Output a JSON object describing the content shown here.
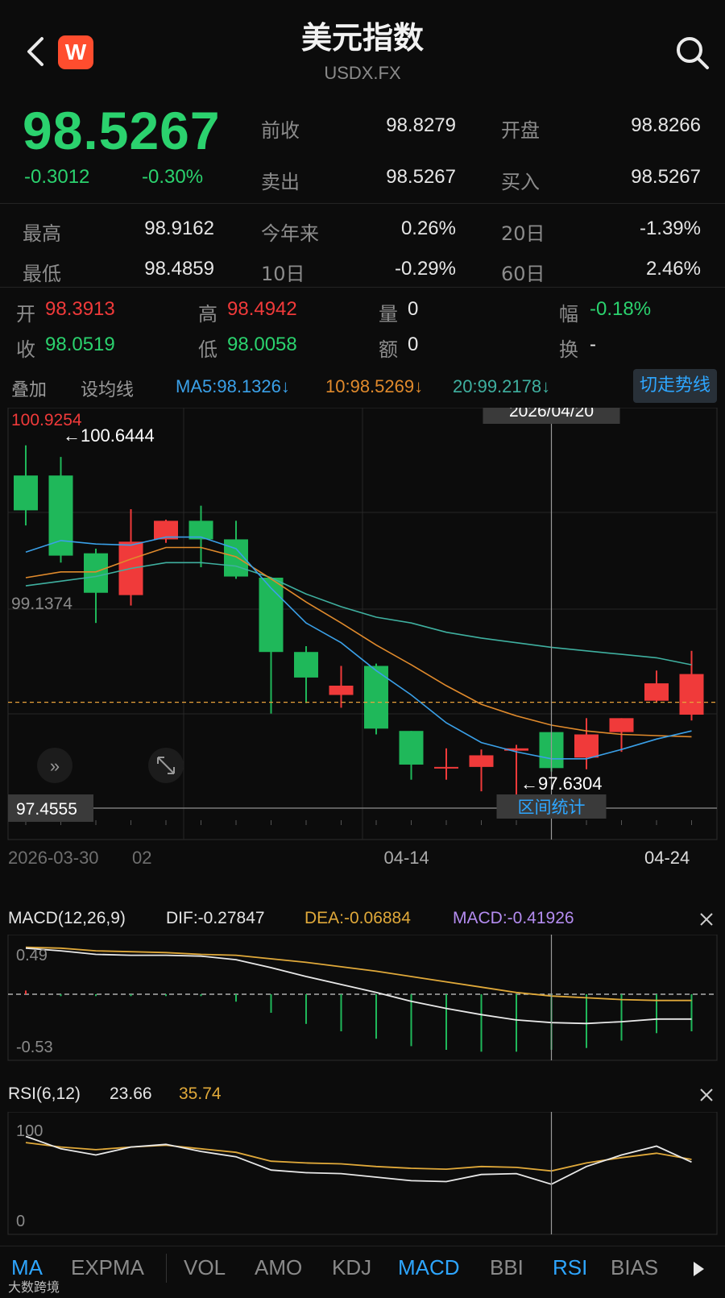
{
  "header": {
    "title": "美元指数",
    "subtitle": "USDX.FX",
    "logo_letter": "W"
  },
  "quote": {
    "price": "98.5267",
    "change": "-0.3012",
    "change_pct": "-0.30%",
    "prev_close_label": "前收",
    "prev_close": "98.8279",
    "open_label": "开盘",
    "open": "98.8266",
    "ask_label": "卖出",
    "ask": "98.5267",
    "bid_label": "买入",
    "bid": "98.5267",
    "high_label": "最高",
    "high": "98.9162",
    "ytd_label": "今年来",
    "ytd": "0.26%",
    "d20_label": "20日",
    "d20": "-1.39%",
    "low_label": "最低",
    "low": "98.4859",
    "d10_label": "10日",
    "d10": "-0.29%",
    "d60_label": "60日",
    "d60": "2.46%"
  },
  "candle_info": {
    "open_label": "开",
    "open": "98.3913",
    "high_label": "高",
    "high": "98.4942",
    "vol_label": "量",
    "vol": "0",
    "amp_label": "幅",
    "amp": "-0.18%",
    "close_label": "收",
    "close": "98.0519",
    "low_label": "低",
    "low": "98.0058",
    "amt_label": "额",
    "amt": "0",
    "turn_label": "换",
    "turn": "-"
  },
  "toolbar": {
    "overlay": "叠加",
    "set_ma": "设均线",
    "ma5": "MA5:98.1326↓",
    "ma10": "10:98.5269↓",
    "ma20": "20:99.2178↓",
    "trend_button": "切走势线"
  },
  "main_chart": {
    "top_price_label": "100.9254",
    "max_annotation": "←100.6444",
    "mid_price_label": "99.1374",
    "bottom_price_label": "97.4555",
    "min_annotation": "←97.6304",
    "crosshair_date": "2026/04/20",
    "range_stats": "区间统计",
    "date_labels": [
      "2026-03-30",
      "02",
      "04-14",
      "04-24"
    ]
  },
  "macd": {
    "title": "MACD(12,26,9)",
    "dif": "DIF:-0.27847",
    "dea": "DEA:-0.06884",
    "macd": "MACD:-0.41926",
    "top_label": "0.49",
    "bottom_label": "-0.53"
  },
  "rsi": {
    "title": "RSI(6,12)",
    "v1": "23.66",
    "v2": "35.74",
    "top_label": "100",
    "bottom_label": "0"
  },
  "tabs": [
    "MA",
    "EXPMA",
    "VOL",
    "AMO",
    "KDJ",
    "MACD",
    "BBI",
    "RSI",
    "BIAS"
  ],
  "watermark": "大数跨境",
  "colors": {
    "up": "#f03a3a",
    "down": "#1fb85a",
    "ma5": "#3aa0e8",
    "ma10": "#e08a2c",
    "ma20": "#3fb0a0",
    "accent": "#2ea6ff"
  },
  "chart_data": {
    "type": "candlestick",
    "ylim": [
      97.4555,
      100.9254
    ],
    "candles": [
      {
        "o": 100.48,
        "c": 100.18,
        "h": 100.74,
        "l": 100.05
      },
      {
        "o": 100.48,
        "c": 99.79,
        "h": 100.64,
        "l": 99.73
      },
      {
        "o": 99.81,
        "c": 99.47,
        "h": 99.85,
        "l": 99.21
      },
      {
        "o": 99.45,
        "c": 99.91,
        "h": 100.19,
        "l": 99.36
      },
      {
        "o": 99.93,
        "c": 100.09,
        "h": 100.1,
        "l": 99.9
      },
      {
        "o": 100.09,
        "c": 99.93,
        "h": 100.22,
        "l": 99.69
      },
      {
        "o": 99.93,
        "c": 99.61,
        "h": 100.09,
        "l": 99.59
      },
      {
        "o": 99.6,
        "c": 98.96,
        "h": 99.6,
        "l": 98.43
      },
      {
        "o": 98.96,
        "c": 98.74,
        "h": 99.01,
        "l": 98.52
      },
      {
        "o": 98.59,
        "c": 98.67,
        "h": 98.84,
        "l": 98.48
      },
      {
        "o": 98.84,
        "c": 98.3,
        "h": 98.86,
        "l": 98.25
      },
      {
        "o": 98.28,
        "c": 97.99,
        "h": 98.28,
        "l": 97.86
      },
      {
        "o": 97.97,
        "c": 97.97,
        "h": 98.13,
        "l": 97.86
      },
      {
        "o": 97.97,
        "c": 98.07,
        "h": 98.12,
        "l": 97.76
      },
      {
        "o": 98.11,
        "c": 98.13,
        "h": 98.16,
        "l": 97.63
      },
      {
        "o": 98.27,
        "c": 97.96,
        "h": 98.27,
        "l": 97.93
      },
      {
        "o": 98.05,
        "c": 98.25,
        "h": 98.39,
        "l": 97.95
      },
      {
        "o": 98.27,
        "c": 98.39,
        "h": 98.39,
        "l": 98.1
      },
      {
        "o": 98.54,
        "c": 98.69,
        "h": 98.8,
        "l": 98.53
      },
      {
        "o": 98.42,
        "c": 98.77,
        "h": 98.97,
        "l": 98.37
      }
    ],
    "ma5": [
      99.82,
      99.92,
      99.89,
      99.88,
      99.95,
      99.95,
      99.85,
      99.51,
      99.21,
      99.04,
      98.8,
      98.59,
      98.35,
      98.18,
      98.1,
      98.04,
      98.04,
      98.12,
      98.21,
      98.28
    ],
    "ma10": [
      99.6,
      99.65,
      99.65,
      99.76,
      99.86,
      99.86,
      99.78,
      99.59,
      99.39,
      99.21,
      99.02,
      98.85,
      98.67,
      98.51,
      98.41,
      98.33,
      98.28,
      98.25,
      98.24,
      98.23
    ],
    "ma20": [
      99.53,
      99.57,
      99.61,
      99.68,
      99.73,
      99.73,
      99.7,
      99.6,
      99.46,
      99.35,
      99.26,
      99.21,
      99.13,
      99.08,
      99.04,
      99.0,
      98.97,
      98.94,
      98.91,
      98.85
    ],
    "macd_dif": [
      0.52,
      0.49,
      0.45,
      0.44,
      0.44,
      0.43,
      0.39,
      0.3,
      0.2,
      0.11,
      0.02,
      -0.08,
      -0.16,
      -0.23,
      -0.29,
      -0.32,
      -0.33,
      -0.31,
      -0.28,
      -0.28
    ],
    "macd_dea": [
      0.53,
      0.52,
      0.49,
      0.48,
      0.47,
      0.45,
      0.44,
      0.4,
      0.36,
      0.31,
      0.26,
      0.2,
      0.14,
      0.08,
      0.02,
      -0.02,
      -0.04,
      -0.06,
      -0.07,
      -0.07
    ],
    "macd_hist": [
      0.02,
      -0.01,
      -0.01,
      -0.01,
      -0.01,
      -0.01,
      -0.04,
      -0.1,
      -0.16,
      -0.2,
      -0.24,
      -0.28,
      -0.3,
      -0.31,
      -0.31,
      -0.3,
      -0.29,
      -0.25,
      -0.21,
      -0.2
    ],
    "rsi6": [
      76,
      62,
      55,
      64,
      67,
      59,
      53,
      38,
      35,
      34,
      30,
      26,
      25,
      33,
      34,
      22,
      42,
      55,
      65,
      47
    ],
    "rsi12": [
      69,
      64,
      61,
      64,
      66,
      62,
      58,
      48,
      46,
      45,
      42,
      40,
      39,
      42,
      41,
      37,
      46,
      52,
      57,
      50
    ]
  }
}
